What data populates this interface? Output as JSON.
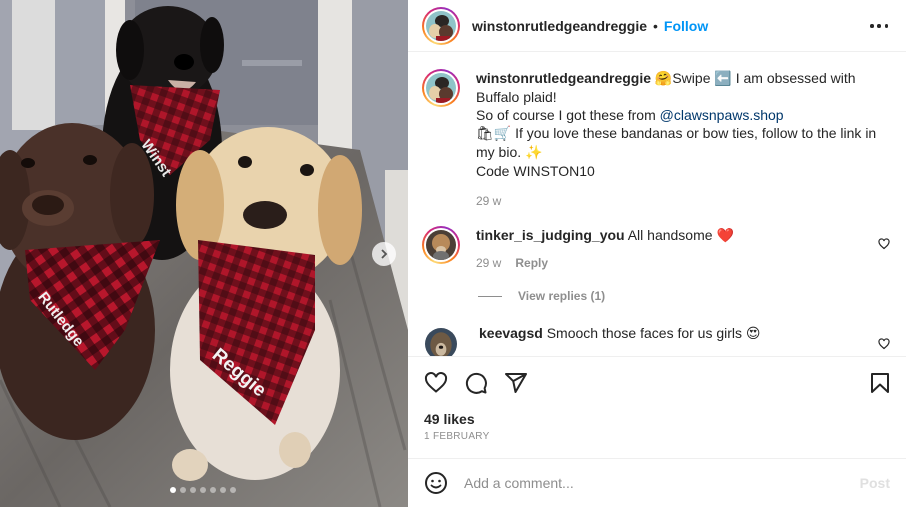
{
  "post": {
    "author": "winstonrutledgeandreggie",
    "separator": "•",
    "follow_label": "Follow",
    "more_label": "More options"
  },
  "photo": {
    "alt": "Three labrador dogs (chocolate, black, yellow) wearing red buffalo plaid bandanas named Rutledge, Winston and Reggie",
    "bandana_names": [
      "Winston",
      "Rutledge",
      "Reggie"
    ],
    "carousel": {
      "total_slides": 7,
      "current_slide": 1
    },
    "next_label": "Next"
  },
  "caption": {
    "username": "winstonrutledgeandreggie",
    "emoji_hug": "🤗",
    "text_1": "Swipe ",
    "emoji_arrow": "⬅️",
    "text_2": " I am obsessed with Buffalo plaid!",
    "text_3": "So of course I got these from ",
    "mention": "@clawsnpaws.shop",
    "emoji_shop": "🛍🛒",
    "text_4": " If you love these bandanas or bow ties, follow to the link in my bio. ",
    "emoji_sparkles": "✨",
    "text_5": "Code WINSTON10",
    "time": "29 w"
  },
  "comments": [
    {
      "username": "tinker_is_judging_you",
      "text": " All handsome ",
      "emoji": "❤️",
      "time": "29 w",
      "reply_label": "Reply",
      "view_replies_label": "View replies (1)"
    },
    {
      "username": "keevagsd",
      "text": " Smooch those faces for us girls ",
      "emoji": "😍"
    }
  ],
  "actions": {
    "like_label": "Like",
    "comment_label": "Comment",
    "share_label": "Share",
    "save_label": "Save"
  },
  "likes": "49 likes",
  "date": "1 FEBRUARY",
  "add_comment": {
    "placeholder": "Add a comment...",
    "value": "",
    "post_label": "Post"
  },
  "colors": {
    "link_blue": "#0095f6",
    "mention_blue": "#00376b",
    "secondary_text": "#8e8e8e",
    "primary_text": "#262626",
    "divider": "#efefef",
    "heart_red": "#e0203a"
  }
}
